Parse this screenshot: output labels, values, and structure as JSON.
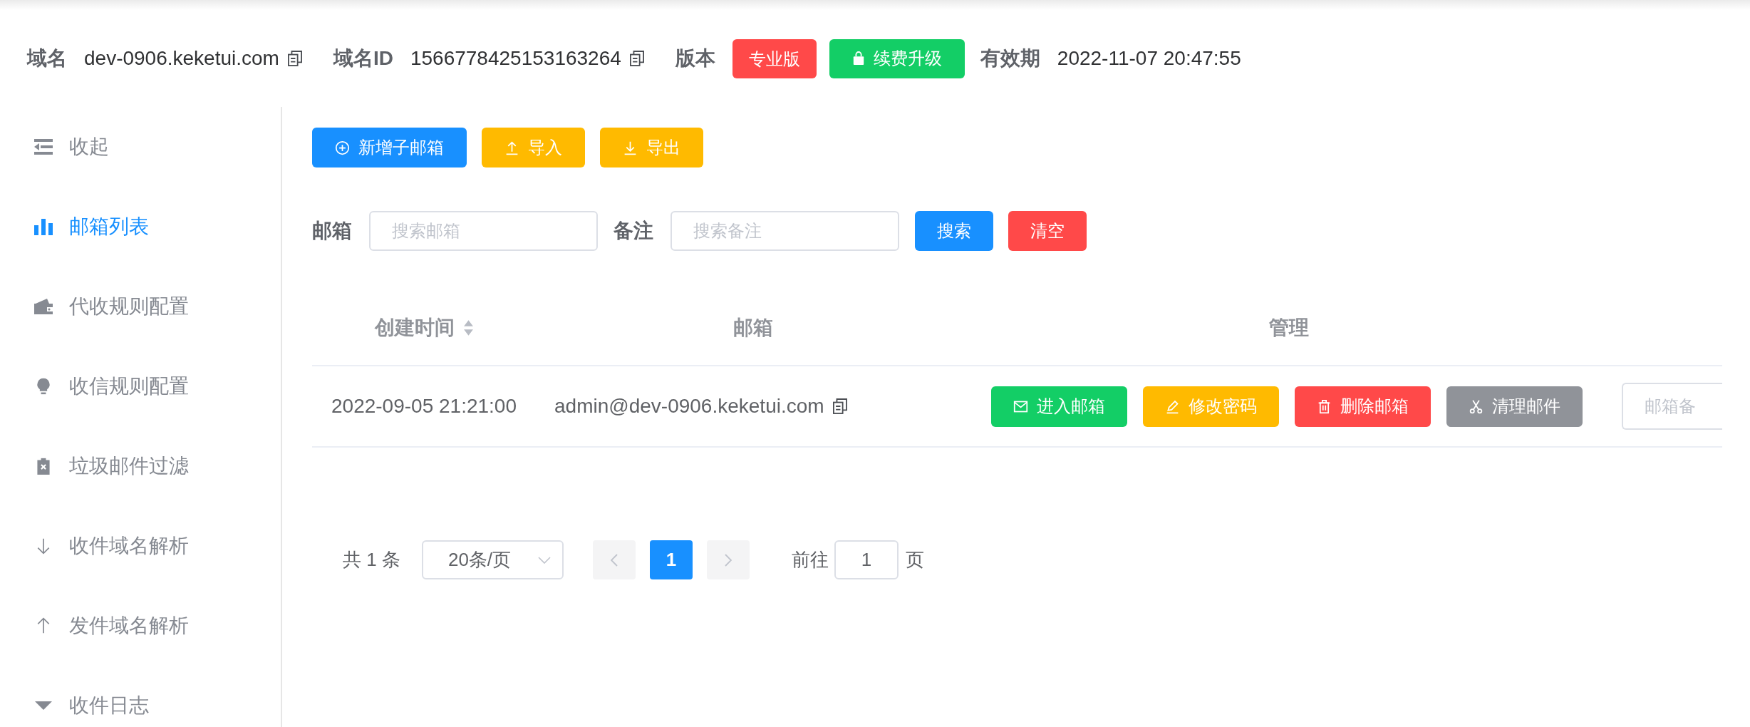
{
  "header": {
    "domain": {
      "label": "域名",
      "value": "dev-0906.keketui.com"
    },
    "domain_id": {
      "label": "域名ID",
      "value": "1566778425153163264"
    },
    "edition": {
      "label": "版本",
      "badge": "专业版"
    },
    "renew_button": "续费升级",
    "expiry": {
      "label": "有效期",
      "value": "2022-11-07 20:47:55"
    }
  },
  "sidebar": {
    "items": [
      {
        "label": "收起",
        "selected": false
      },
      {
        "label": "邮箱列表",
        "selected": true
      },
      {
        "label": "代收规则配置",
        "selected": false
      },
      {
        "label": "收信规则配置",
        "selected": false
      },
      {
        "label": "垃圾邮件过滤",
        "selected": false
      },
      {
        "label": "收件域名解析",
        "selected": false
      },
      {
        "label": "发件域名解析",
        "selected": false
      },
      {
        "label": "收件日志",
        "selected": false
      }
    ]
  },
  "toolbar": {
    "buttons": [
      {
        "label": "新增子邮箱",
        "kind": "primary"
      },
      {
        "label": "导入",
        "kind": "warning"
      },
      {
        "label": "导出",
        "kind": "warning"
      }
    ]
  },
  "search": {
    "fields": [
      {
        "label": "邮箱",
        "placeholder": "搜索邮箱"
      },
      {
        "label": "备注",
        "placeholder": "搜索备注"
      }
    ],
    "buttons": [
      {
        "label": "搜索",
        "kind": "primary"
      },
      {
        "label": "清空",
        "kind": "danger"
      }
    ]
  },
  "table": {
    "columns": [
      {
        "label": "创建时间",
        "sortable": true
      },
      {
        "label": "邮箱",
        "sortable": false
      },
      {
        "label": "管理",
        "sortable": false
      }
    ],
    "rows": [
      {
        "created": "2022-09-05 21:21:00",
        "email": "admin@dev-0906.keketui.com",
        "actions": [
          {
            "label": "进入邮箱",
            "kind": "success"
          },
          {
            "label": "修改密码",
            "kind": "warning"
          },
          {
            "label": "删除邮箱",
            "kind": "danger"
          },
          {
            "label": "清理邮件",
            "kind": "info"
          }
        ],
        "note": {
          "placeholder": "邮箱备"
        }
      }
    ]
  },
  "pagination": {
    "total": "共 1 条",
    "page_size": "20条/页",
    "prev": {
      "disabled": true
    },
    "pages": [
      {
        "label": "1",
        "selected": true
      }
    ],
    "next": {
      "disabled": true
    },
    "jump": {
      "label": "前往",
      "value": "1",
      "suffix": "页"
    }
  }
}
